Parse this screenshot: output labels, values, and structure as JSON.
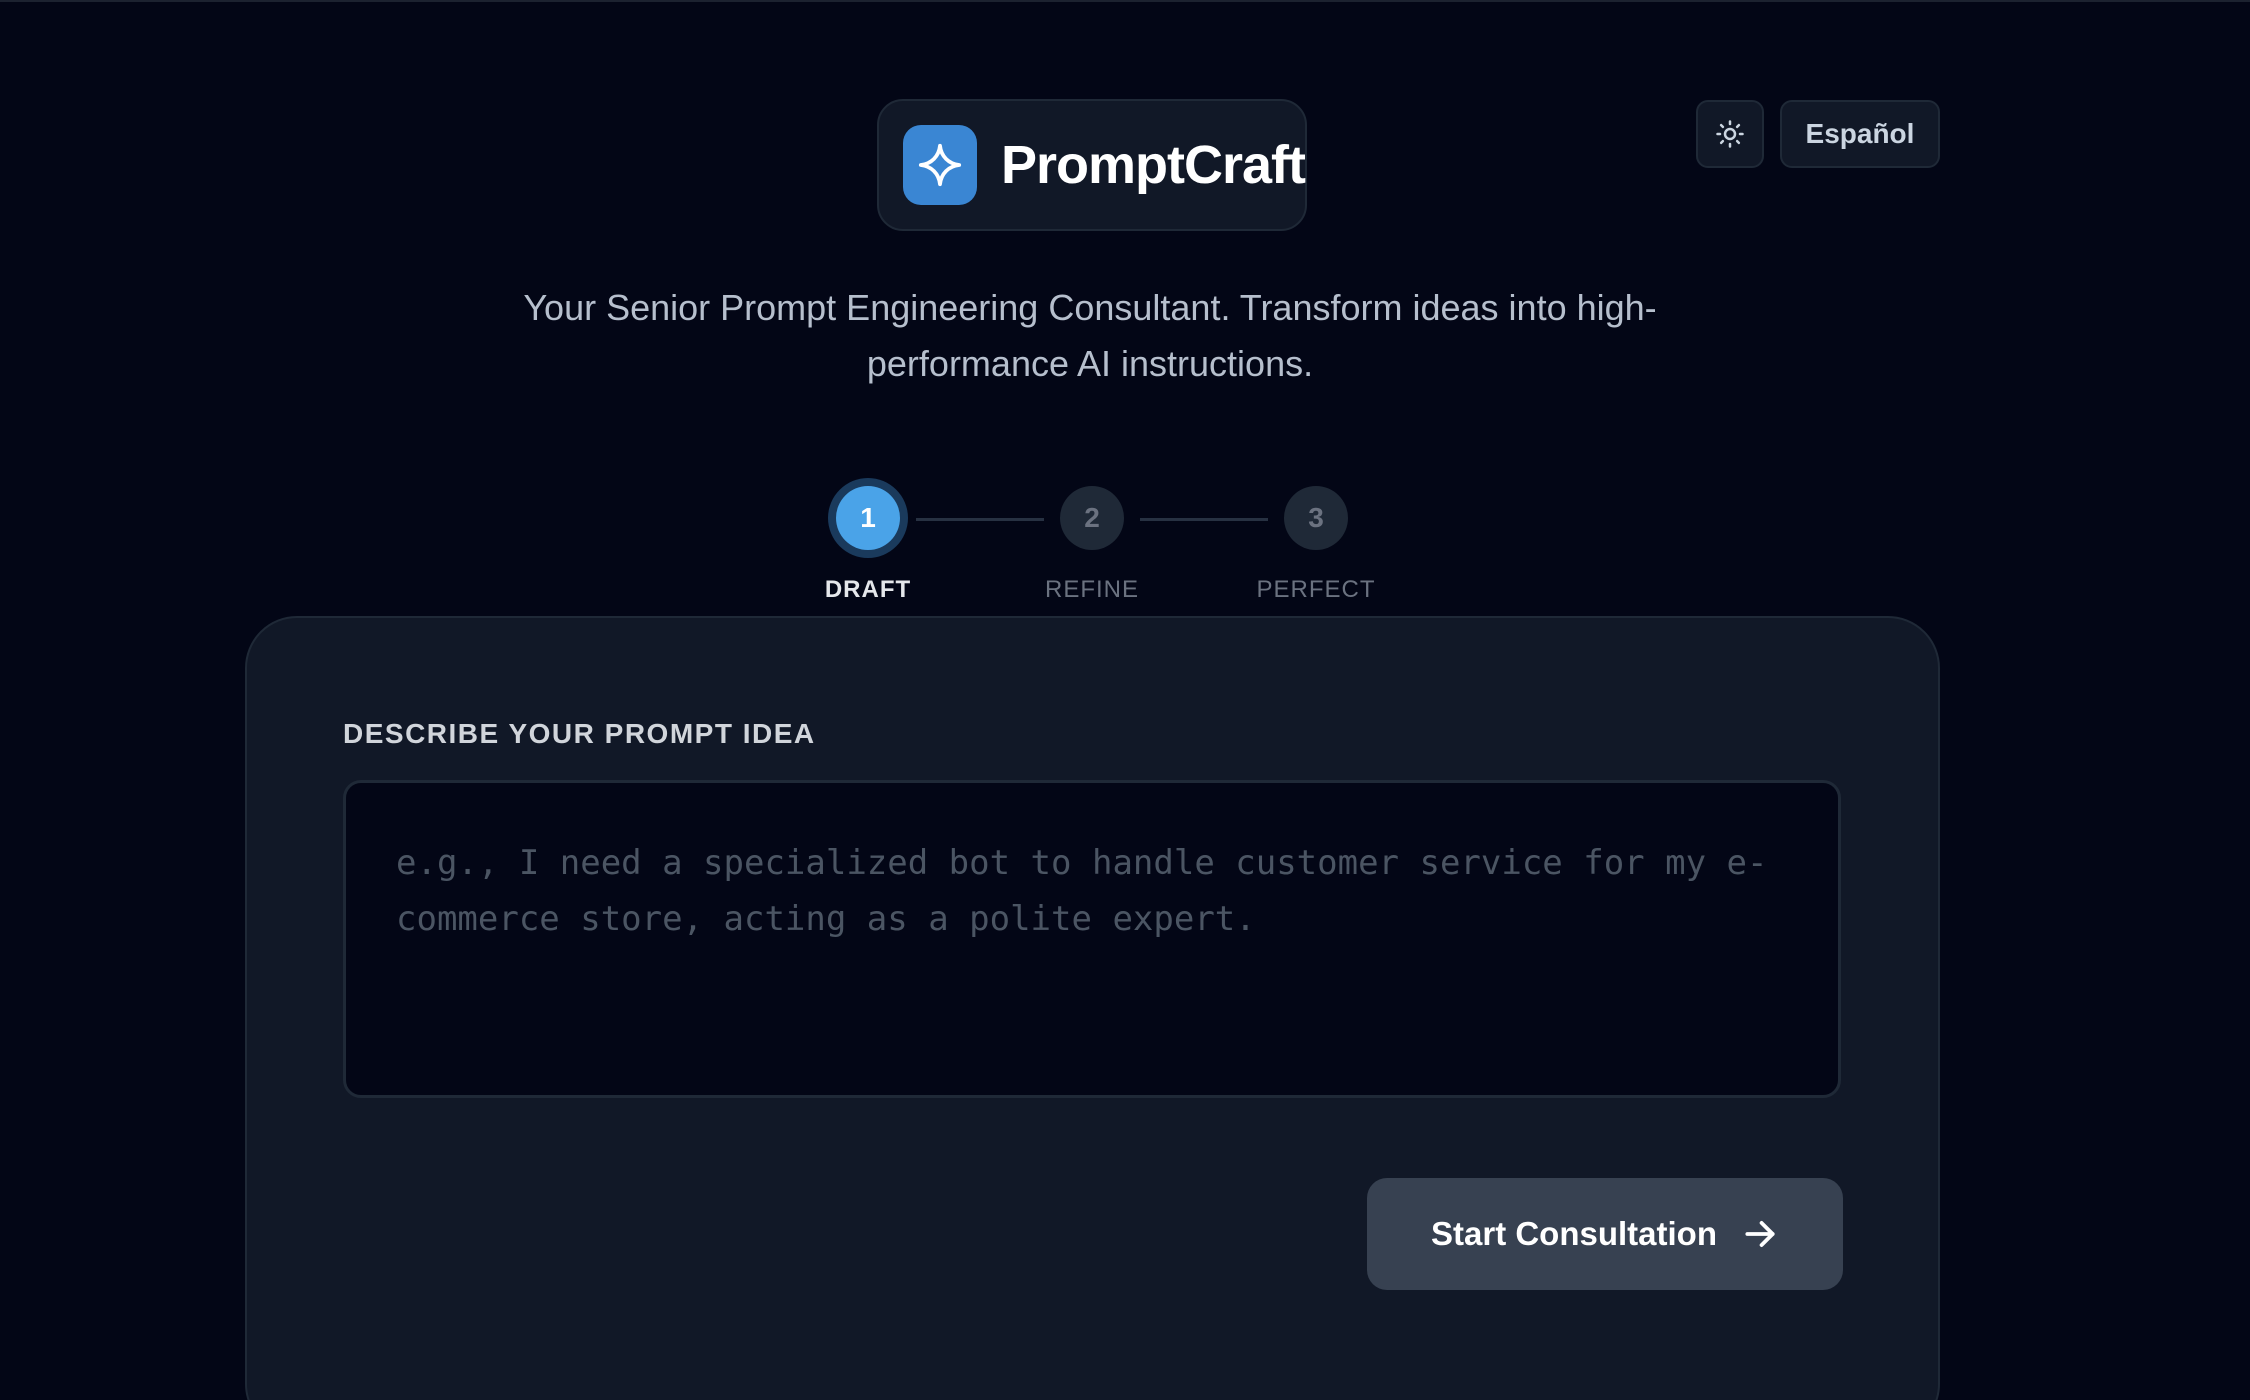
{
  "app": {
    "name": "PromptCraft",
    "logo_icon": "sparkle-icon",
    "tagline": "Your Senior Prompt Engineering Consultant. Transform ideas into high-performance AI instructions."
  },
  "header": {
    "theme_toggle_icon": "sun-icon",
    "language_label": "Español"
  },
  "stepper": {
    "steps": [
      {
        "number": "1",
        "label": "DRAFT",
        "state": "active"
      },
      {
        "number": "2",
        "label": "REFINE",
        "state": "inactive"
      },
      {
        "number": "3",
        "label": "PERFECT",
        "state": "inactive"
      }
    ]
  },
  "form": {
    "label": "DESCRIBE YOUR PROMPT IDEA",
    "input_value": "",
    "input_placeholder": "e.g., I need a specialized bot to handle customer service for my e-commerce store, acting as a polite expert.",
    "submit_label": "Start Consultation",
    "submit_icon": "arrow-right-icon"
  },
  "colors": {
    "background": "#030616",
    "surface": "#111827",
    "accent": "#4aa3e8",
    "logo_badge": "#3a86d3",
    "button": "#374151"
  }
}
